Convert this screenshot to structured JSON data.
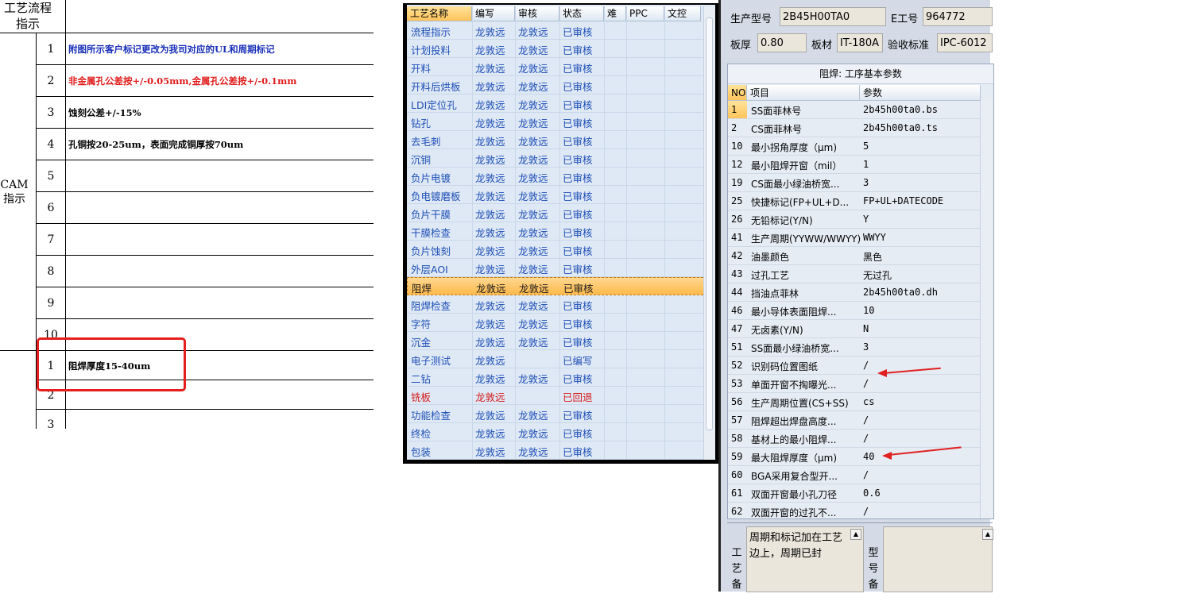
{
  "sheet": {
    "header_title": "工艺流程指示",
    "cam_label": "CAM指示",
    "rows": [
      {
        "num": "1",
        "text": "附图所示客户标记更改为我司对应的UL和周期标记",
        "color": "#1a2fb8"
      },
      {
        "num": "2",
        "text": "非金属孔公差按+/-0.05mm,金属孔公差按+/-0.1mm",
        "color": "#e01b1b"
      },
      {
        "num": "3",
        "text": "蚀刻公差+/-15%",
        "color": "#000000"
      },
      {
        "num": "4",
        "text": "孔铜按20-25um，表面完成铜厚按70um",
        "color": "#000000"
      },
      {
        "num": "5",
        "text": "",
        "color": "#000000"
      },
      {
        "num": "6",
        "text": "",
        "color": "#000000"
      },
      {
        "num": "7",
        "text": "",
        "color": "#000000"
      },
      {
        "num": "8",
        "text": "",
        "color": "#000000"
      },
      {
        "num": "9",
        "text": "",
        "color": "#000000"
      },
      {
        "num": "10",
        "text": "",
        "color": "#000000"
      }
    ],
    "rows2": [
      {
        "num": "1",
        "text": "阻焊厚度15-40um"
      },
      {
        "num": "2",
        "text": ""
      },
      {
        "num": "3",
        "text": ""
      }
    ]
  },
  "process_list": {
    "columns": [
      "工艺名称",
      "编写",
      "审核",
      "状态",
      "难",
      "PPC",
      "文控"
    ],
    "rows": [
      {
        "name": "流程指示",
        "writer": "龙敦远",
        "reviewer": "龙敦远",
        "status": "已审核"
      },
      {
        "name": "计划投料",
        "writer": "龙敦远",
        "reviewer": "龙敦远",
        "status": "已审核"
      },
      {
        "name": "开料",
        "writer": "龙敦远",
        "reviewer": "龙敦远",
        "status": "已审核"
      },
      {
        "name": "开料后烘板",
        "writer": "龙敦远",
        "reviewer": "龙敦远",
        "status": "已审核"
      },
      {
        "name": "LDI定位孔",
        "writer": "龙敦远",
        "reviewer": "龙敦远",
        "status": "已审核"
      },
      {
        "name": "钻孔",
        "writer": "龙敦远",
        "reviewer": "龙敦远",
        "status": "已审核"
      },
      {
        "name": "去毛刺",
        "writer": "龙敦远",
        "reviewer": "龙敦远",
        "status": "已审核"
      },
      {
        "name": "沉铜",
        "writer": "龙敦远",
        "reviewer": "龙敦远",
        "status": "已审核"
      },
      {
        "name": "负片电镀",
        "writer": "龙敦远",
        "reviewer": "龙敦远",
        "status": "已审核"
      },
      {
        "name": "负电镀磨板",
        "writer": "龙敦远",
        "reviewer": "龙敦远",
        "status": "已审核"
      },
      {
        "name": "负片干膜",
        "writer": "龙敦远",
        "reviewer": "龙敦远",
        "status": "已审核"
      },
      {
        "name": "干膜检查",
        "writer": "龙敦远",
        "reviewer": "龙敦远",
        "status": "已审核"
      },
      {
        "name": "负片蚀刻",
        "writer": "龙敦远",
        "reviewer": "龙敦远",
        "status": "已审核"
      },
      {
        "name": "外层AOI",
        "writer": "龙敦远",
        "reviewer": "龙敦远",
        "status": "已审核"
      },
      {
        "name": "阻焊",
        "writer": "龙敦远",
        "reviewer": "龙敦远",
        "status": "已审核",
        "selected": true
      },
      {
        "name": "阻焊检查",
        "writer": "龙敦远",
        "reviewer": "龙敦远",
        "status": "已审核"
      },
      {
        "name": "字符",
        "writer": "龙敦远",
        "reviewer": "龙敦远",
        "status": "已审核"
      },
      {
        "name": "沉金",
        "writer": "龙敦远",
        "reviewer": "龙敦远",
        "status": "已审核"
      },
      {
        "name": "电子测试",
        "writer": "龙敦远",
        "reviewer": "",
        "status": "已编写"
      },
      {
        "name": "二钻",
        "writer": "龙敦远",
        "reviewer": "龙敦远",
        "status": "已审核"
      },
      {
        "name": "铣板",
        "writer": "龙敦远",
        "reviewer": "",
        "status": "已回退",
        "red": true
      },
      {
        "name": "功能检查",
        "writer": "龙敦远",
        "reviewer": "龙敦远",
        "status": "已审核"
      },
      {
        "name": "终检",
        "writer": "龙敦远",
        "reviewer": "龙敦远",
        "status": "已审核"
      },
      {
        "name": "包装",
        "writer": "龙敦远",
        "reviewer": "龙敦远",
        "status": "已审核"
      }
    ]
  },
  "info": {
    "model_label": "生产型号",
    "model_value": "2B45H00TA0",
    "eng_label": "E工号",
    "eng_value": "964772",
    "thickness_label": "板厚",
    "thickness_value": "0.80",
    "material_label": "板材",
    "material_value": "IT-180A",
    "standard_label": "验收标准",
    "standard_value": "IPC-6012"
  },
  "params": {
    "title": "阻焊: 工序基本参数",
    "col_no": "NO",
    "col_item": "项目",
    "col_value": "参数",
    "rows": [
      {
        "no": "1",
        "item": "SS面菲林号",
        "value": "2b45h00ta0.bs"
      },
      {
        "no": "2",
        "item": "CS面菲林号",
        "value": "2b45h00ta0.ts"
      },
      {
        "no": "10",
        "item": "最小拐角厚度（μm)",
        "value": "5"
      },
      {
        "no": "12",
        "item": "最小阻焊开窗（mil）",
        "value": "1"
      },
      {
        "no": "19",
        "item": "CS面最小绿油桥宽...",
        "value": "3"
      },
      {
        "no": "25",
        "item": "快捷标记(FP+UL+D...",
        "value": "FP+UL+DATECODE"
      },
      {
        "no": "26",
        "item": "无铅标记(Y/N)",
        "value": "Y"
      },
      {
        "no": "41",
        "item": "生产周期(YYWW/WWYY)",
        "value": "WWYY"
      },
      {
        "no": "42",
        "item": "油墨颜色",
        "value": "黑色"
      },
      {
        "no": "43",
        "item": "过孔工艺",
        "value": "无过孔"
      },
      {
        "no": "44",
        "item": "挡油点菲林",
        "value": "2b45h00ta0.dh"
      },
      {
        "no": "46",
        "item": "最小导体表面阻焊...",
        "value": "10"
      },
      {
        "no": "47",
        "item": "无卤素(Y/N)",
        "value": "N"
      },
      {
        "no": "51",
        "item": "SS面最小绿油桥宽...",
        "value": "3"
      },
      {
        "no": "52",
        "item": "识别码位置图纸",
        "value": "/"
      },
      {
        "no": "53",
        "item": "单面开窗不掏曝光...",
        "value": "/"
      },
      {
        "no": "56",
        "item": "生产周期位置(CS+SS)",
        "value": "cs"
      },
      {
        "no": "57",
        "item": "阻焊超出焊盘高度...",
        "value": "/"
      },
      {
        "no": "58",
        "item": "基材上的最小阻焊...",
        "value": "/"
      },
      {
        "no": "59",
        "item": "最大阻焊厚度（μm)",
        "value": "40"
      },
      {
        "no": "60",
        "item": "BGA采用复合型开...",
        "value": "/"
      },
      {
        "no": "61",
        "item": "双面开窗最小孔刀径",
        "value": "0.6"
      },
      {
        "no": "62",
        "item": "双面开窗的过孔不...",
        "value": "/"
      }
    ]
  },
  "notes": {
    "process_note_label": [
      "工",
      "艺",
      "备"
    ],
    "process_note_text": "周期和标记加在工艺边上，周期已封",
    "model_note_label": [
      "型",
      "号",
      "备"
    ],
    "model_note_text": ""
  },
  "colors": {
    "accent_orange": "#ffc45a",
    "link_blue": "#1f4fb6",
    "alert_red": "#d41c1c",
    "annotation_red": "#e51e1e"
  }
}
